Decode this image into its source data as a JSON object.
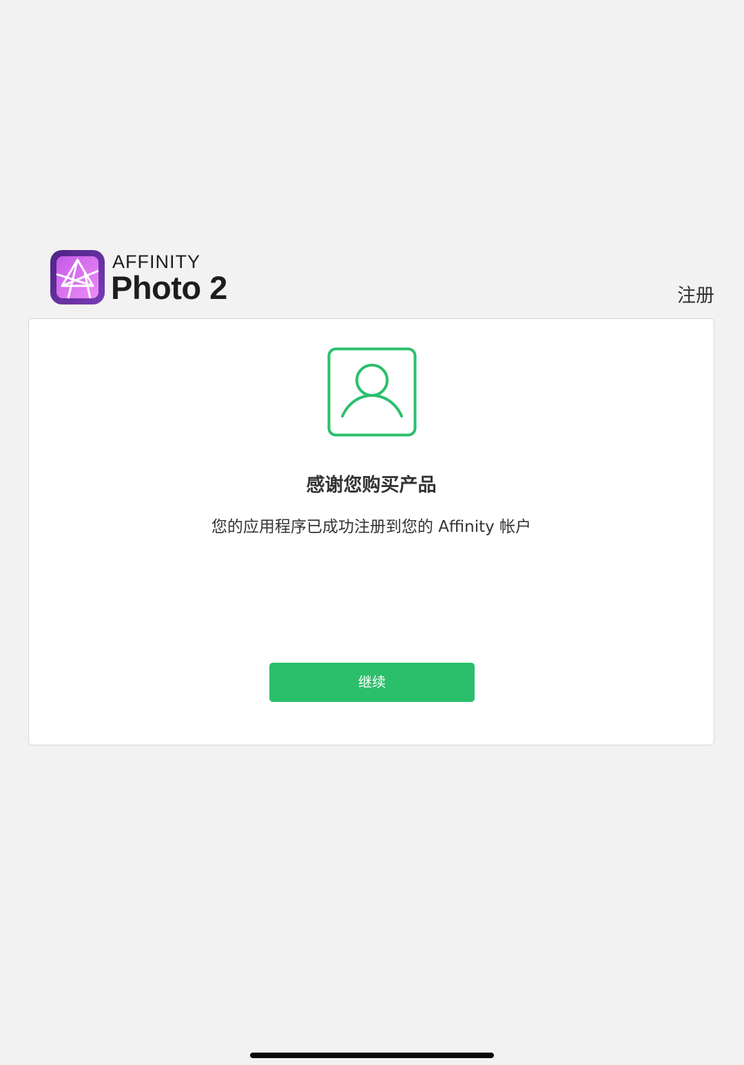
{
  "header": {
    "logo": {
      "brand": "AFFINITY",
      "product": "Photo 2",
      "icon": "affinity-photo-aperture-icon"
    },
    "register_label": "注册"
  },
  "card": {
    "icon": "user-account-icon",
    "title": "感谢您购买产品",
    "message": "您的应用程序已成功注册到您的 Affinity 帐户",
    "continue_label": "继续"
  },
  "colors": {
    "background": "#f2f2f2",
    "card": "#ffffff",
    "accent_green": "#2bbf6c",
    "text": "#333333",
    "logo_gradient_start": "#5e2a9e",
    "logo_gradient_end": "#e472f5"
  }
}
